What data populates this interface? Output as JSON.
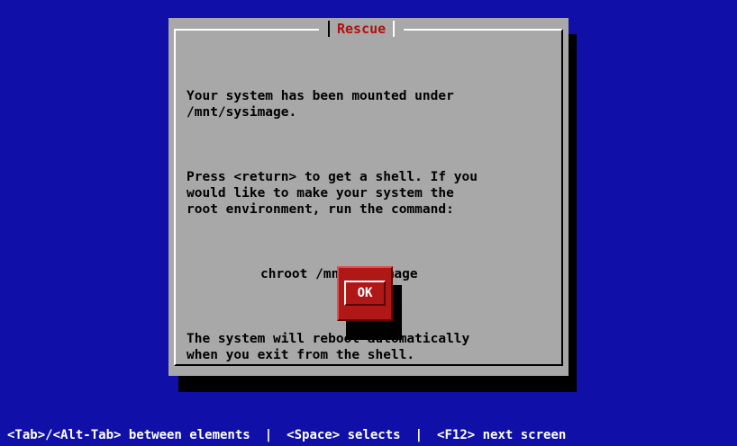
{
  "dialog": {
    "title": "Rescue",
    "paragraphs": [
      "Your system has been mounted under\n/mnt/sysimage.",
      "Press <return> to get a shell. If you\nwould like to make your system the\nroot environment, run the command:",
      "The system will reboot automatically\nwhen you exit from the shell."
    ],
    "command": "chroot /mnt/sysimage",
    "ok_label": "OK"
  },
  "help": {
    "item1": "<Tab>/<Alt-Tab> between elements",
    "separator": "|",
    "item2": "<Space> selects",
    "item3": "<F12> next screen"
  },
  "colors": {
    "background": "#1010a8",
    "dialog": "#a8a8a8",
    "title": "#b01010",
    "button": "#b01818"
  }
}
